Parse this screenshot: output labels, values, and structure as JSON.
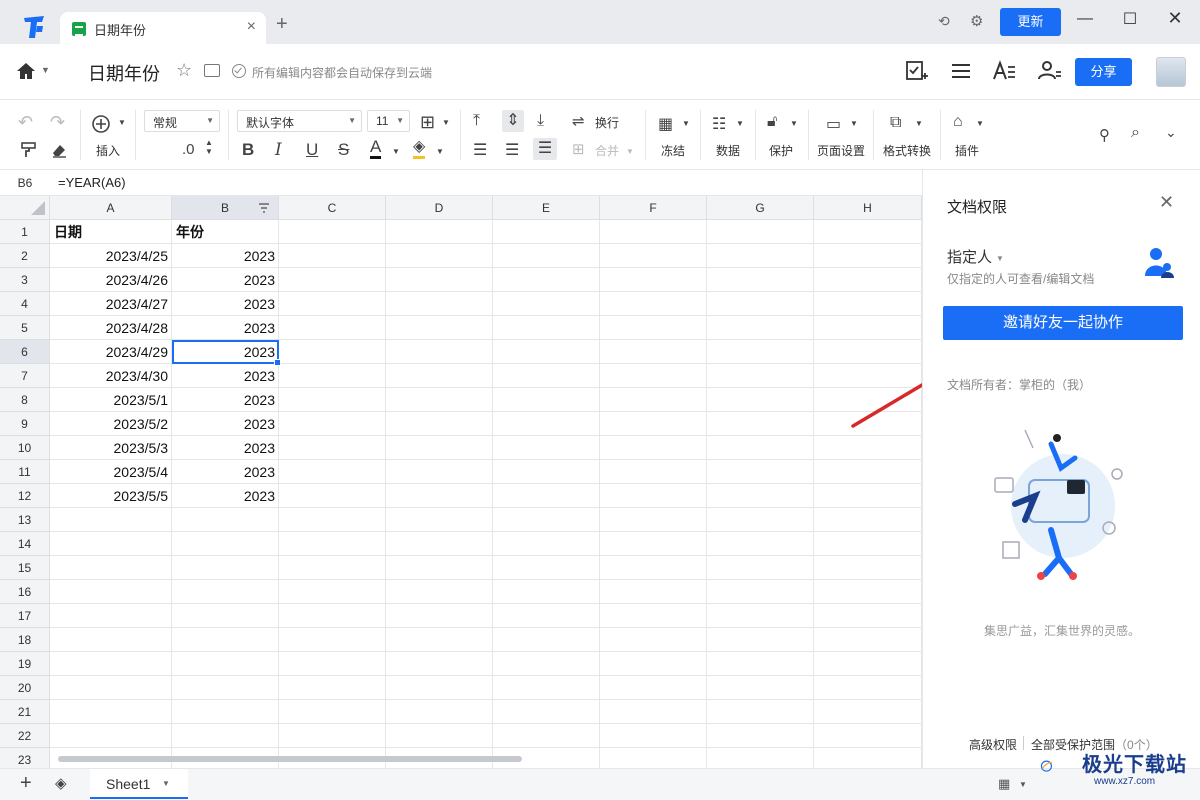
{
  "titlebar": {
    "tab_title": "日期年份",
    "update_label": "更新"
  },
  "header": {
    "doc_title": "日期年份",
    "save_status": "所有编辑内容都会自动保存到云端",
    "share_label": "分享"
  },
  "toolbar": {
    "insert_label": "插入",
    "format_value": "常规",
    "decimal_label": ".0",
    "font_value": "默认字体",
    "size_value": "11",
    "wrap_label": "换行",
    "merge_label": "合并",
    "freeze_label": "冻结",
    "data_label": "数据",
    "protect_label": "保护",
    "page_setup_label": "页面设置",
    "format_convert_label": "格式转换",
    "plugin_label": "插件"
  },
  "formula_bar": {
    "cell_ref": "B6",
    "formula": "=YEAR(A6)"
  },
  "grid": {
    "columns": [
      "A",
      "B",
      "C",
      "D",
      "E",
      "F",
      "G",
      "H"
    ],
    "rows": [
      "1",
      "2",
      "3",
      "4",
      "5",
      "6",
      "7",
      "8",
      "9",
      "10",
      "11",
      "12",
      "13",
      "14",
      "15",
      "16",
      "17",
      "18",
      "19",
      "20",
      "21",
      "22",
      "23"
    ],
    "header_row": [
      "日期",
      "年份"
    ],
    "data": [
      [
        "2023/4/25",
        "2023"
      ],
      [
        "2023/4/26",
        "2023"
      ],
      [
        "2023/4/27",
        "2023"
      ],
      [
        "2023/4/28",
        "2023"
      ],
      [
        "2023/4/29",
        "2023"
      ],
      [
        "2023/4/30",
        "2023"
      ],
      [
        "2023/5/1",
        "2023"
      ],
      [
        "2023/5/2",
        "2023"
      ],
      [
        "2023/5/3",
        "2023"
      ],
      [
        "2023/5/4",
        "2023"
      ],
      [
        "2023/5/5",
        "2023"
      ]
    ],
    "selected_cell": "B6"
  },
  "sheets": {
    "active": "Sheet1"
  },
  "panel": {
    "title": "文档权限",
    "permission": "指定人",
    "permission_desc": "仅指定的人可查看/编辑文档",
    "invite_label": "邀请好友一起协作",
    "owner": "文档所有者：掌柜的（我）",
    "slogan": "集思广益，汇集世界的灵感。",
    "advanced_label": "高级权限",
    "protect_label": "全部受保护范围",
    "protect_count": "（0个）"
  },
  "watermark": {
    "text": "极光下载站",
    "url": "www.xz7.com"
  },
  "colors": {
    "accent": "#1a6ef5",
    "arrow": "#d8282a"
  }
}
